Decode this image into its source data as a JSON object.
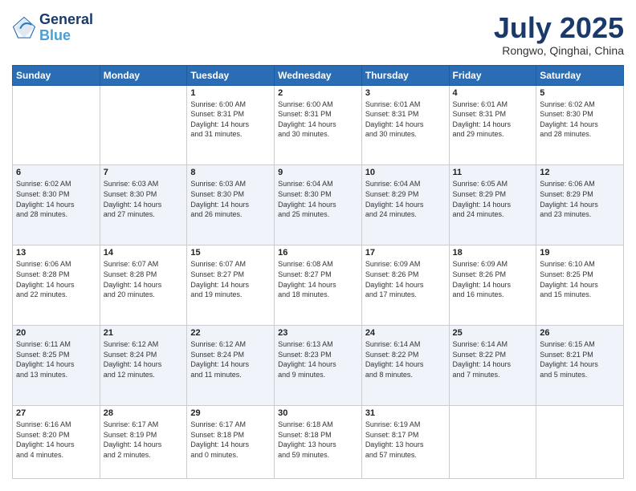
{
  "header": {
    "logo_line1": "General",
    "logo_line2": "Blue",
    "month": "July 2025",
    "location": "Rongwo, Qinghai, China"
  },
  "days_of_week": [
    "Sunday",
    "Monday",
    "Tuesday",
    "Wednesday",
    "Thursday",
    "Friday",
    "Saturday"
  ],
  "weeks": [
    [
      {
        "day": "",
        "info": ""
      },
      {
        "day": "",
        "info": ""
      },
      {
        "day": "1",
        "info": "Sunrise: 6:00 AM\nSunset: 8:31 PM\nDaylight: 14 hours\nand 31 minutes."
      },
      {
        "day": "2",
        "info": "Sunrise: 6:00 AM\nSunset: 8:31 PM\nDaylight: 14 hours\nand 30 minutes."
      },
      {
        "day": "3",
        "info": "Sunrise: 6:01 AM\nSunset: 8:31 PM\nDaylight: 14 hours\nand 30 minutes."
      },
      {
        "day": "4",
        "info": "Sunrise: 6:01 AM\nSunset: 8:31 PM\nDaylight: 14 hours\nand 29 minutes."
      },
      {
        "day": "5",
        "info": "Sunrise: 6:02 AM\nSunset: 8:30 PM\nDaylight: 14 hours\nand 28 minutes."
      }
    ],
    [
      {
        "day": "6",
        "info": "Sunrise: 6:02 AM\nSunset: 8:30 PM\nDaylight: 14 hours\nand 28 minutes."
      },
      {
        "day": "7",
        "info": "Sunrise: 6:03 AM\nSunset: 8:30 PM\nDaylight: 14 hours\nand 27 minutes."
      },
      {
        "day": "8",
        "info": "Sunrise: 6:03 AM\nSunset: 8:30 PM\nDaylight: 14 hours\nand 26 minutes."
      },
      {
        "day": "9",
        "info": "Sunrise: 6:04 AM\nSunset: 8:30 PM\nDaylight: 14 hours\nand 25 minutes."
      },
      {
        "day": "10",
        "info": "Sunrise: 6:04 AM\nSunset: 8:29 PM\nDaylight: 14 hours\nand 24 minutes."
      },
      {
        "day": "11",
        "info": "Sunrise: 6:05 AM\nSunset: 8:29 PM\nDaylight: 14 hours\nand 24 minutes."
      },
      {
        "day": "12",
        "info": "Sunrise: 6:06 AM\nSunset: 8:29 PM\nDaylight: 14 hours\nand 23 minutes."
      }
    ],
    [
      {
        "day": "13",
        "info": "Sunrise: 6:06 AM\nSunset: 8:28 PM\nDaylight: 14 hours\nand 22 minutes."
      },
      {
        "day": "14",
        "info": "Sunrise: 6:07 AM\nSunset: 8:28 PM\nDaylight: 14 hours\nand 20 minutes."
      },
      {
        "day": "15",
        "info": "Sunrise: 6:07 AM\nSunset: 8:27 PM\nDaylight: 14 hours\nand 19 minutes."
      },
      {
        "day": "16",
        "info": "Sunrise: 6:08 AM\nSunset: 8:27 PM\nDaylight: 14 hours\nand 18 minutes."
      },
      {
        "day": "17",
        "info": "Sunrise: 6:09 AM\nSunset: 8:26 PM\nDaylight: 14 hours\nand 17 minutes."
      },
      {
        "day": "18",
        "info": "Sunrise: 6:09 AM\nSunset: 8:26 PM\nDaylight: 14 hours\nand 16 minutes."
      },
      {
        "day": "19",
        "info": "Sunrise: 6:10 AM\nSunset: 8:25 PM\nDaylight: 14 hours\nand 15 minutes."
      }
    ],
    [
      {
        "day": "20",
        "info": "Sunrise: 6:11 AM\nSunset: 8:25 PM\nDaylight: 14 hours\nand 13 minutes."
      },
      {
        "day": "21",
        "info": "Sunrise: 6:12 AM\nSunset: 8:24 PM\nDaylight: 14 hours\nand 12 minutes."
      },
      {
        "day": "22",
        "info": "Sunrise: 6:12 AM\nSunset: 8:24 PM\nDaylight: 14 hours\nand 11 minutes."
      },
      {
        "day": "23",
        "info": "Sunrise: 6:13 AM\nSunset: 8:23 PM\nDaylight: 14 hours\nand 9 minutes."
      },
      {
        "day": "24",
        "info": "Sunrise: 6:14 AM\nSunset: 8:22 PM\nDaylight: 14 hours\nand 8 minutes."
      },
      {
        "day": "25",
        "info": "Sunrise: 6:14 AM\nSunset: 8:22 PM\nDaylight: 14 hours\nand 7 minutes."
      },
      {
        "day": "26",
        "info": "Sunrise: 6:15 AM\nSunset: 8:21 PM\nDaylight: 14 hours\nand 5 minutes."
      }
    ],
    [
      {
        "day": "27",
        "info": "Sunrise: 6:16 AM\nSunset: 8:20 PM\nDaylight: 14 hours\nand 4 minutes."
      },
      {
        "day": "28",
        "info": "Sunrise: 6:17 AM\nSunset: 8:19 PM\nDaylight: 14 hours\nand 2 minutes."
      },
      {
        "day": "29",
        "info": "Sunrise: 6:17 AM\nSunset: 8:18 PM\nDaylight: 14 hours\nand 0 minutes."
      },
      {
        "day": "30",
        "info": "Sunrise: 6:18 AM\nSunset: 8:18 PM\nDaylight: 13 hours\nand 59 minutes."
      },
      {
        "day": "31",
        "info": "Sunrise: 6:19 AM\nSunset: 8:17 PM\nDaylight: 13 hours\nand 57 minutes."
      },
      {
        "day": "",
        "info": ""
      },
      {
        "day": "",
        "info": ""
      }
    ]
  ]
}
